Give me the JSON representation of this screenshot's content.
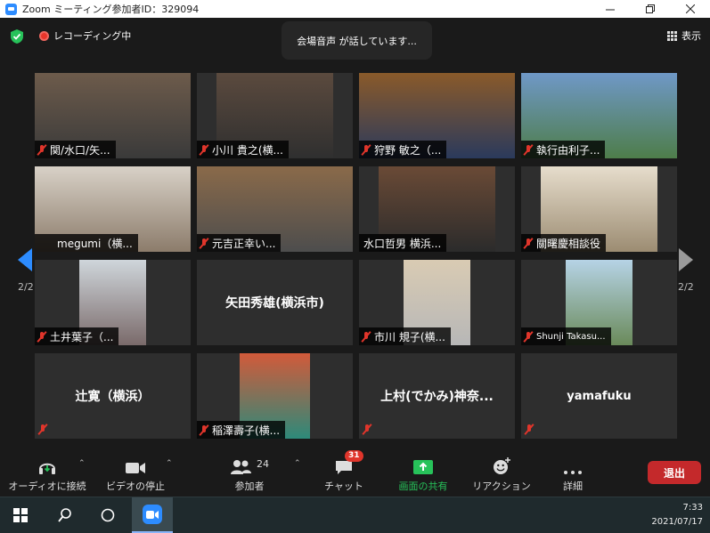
{
  "window": {
    "title": "Zoom ミーティング参加者ID：329094",
    "controls": [
      "minimize",
      "maximize",
      "close"
    ]
  },
  "topbar": {
    "recording_label": "レコーディング中",
    "speaking_label": "会場音声 が話しています...",
    "view_label": "表示"
  },
  "navigation": {
    "page_left": "2/2",
    "page_right": "2/2"
  },
  "participants": [
    {
      "name": "関/水口/矢...",
      "muted": true,
      "video": true
    },
    {
      "name": "小川 貴之(横...",
      "muted": true,
      "video": true
    },
    {
      "name": "狩野 敏之（...",
      "muted": true,
      "video": true
    },
    {
      "name": "執行由利子...",
      "muted": true,
      "video": true
    },
    {
      "name": "megumi（横...",
      "muted": false,
      "video": true
    },
    {
      "name": "元吉正幸い...",
      "muted": true,
      "video": true
    },
    {
      "name": "水口哲男 横浜...",
      "muted": false,
      "video": true
    },
    {
      "name": "關曙慶相談役",
      "muted": true,
      "video": true
    },
    {
      "name": "土井葉子（...",
      "muted": true,
      "video": true
    },
    {
      "name": "矢田秀雄(横浜市)",
      "muted": false,
      "video": false
    },
    {
      "name": "市川 規子(横...",
      "muted": true,
      "video": true
    },
    {
      "name": "Shunji Takasu...",
      "muted": true,
      "video": true
    },
    {
      "name": "辻寛（横浜）",
      "muted": true,
      "video": false
    },
    {
      "name": "稲澤壽子(横...",
      "muted": true,
      "video": true
    },
    {
      "name": "上村(でかみ)神奈...",
      "muted": true,
      "video": false
    },
    {
      "name": "yamafuku",
      "muted": true,
      "video": false
    }
  ],
  "toolbar": {
    "audio_label": "オーディオに接続",
    "video_label": "ビデオの停止",
    "participants_label": "参加者",
    "participants_count": "24",
    "chat_label": "チャット",
    "chat_badge": "31",
    "share_label": "画面の共有",
    "reaction_label": "リアクション",
    "more_label": "詳細",
    "leave_label": "退出"
  },
  "taskbar": {
    "time": "7:33",
    "date": "2021/07/17"
  },
  "colors": {
    "zoom_blue": "#2d8cff",
    "share_green": "#27c25a",
    "leave_red": "#c4292b",
    "mute_red": "#e0352b"
  }
}
